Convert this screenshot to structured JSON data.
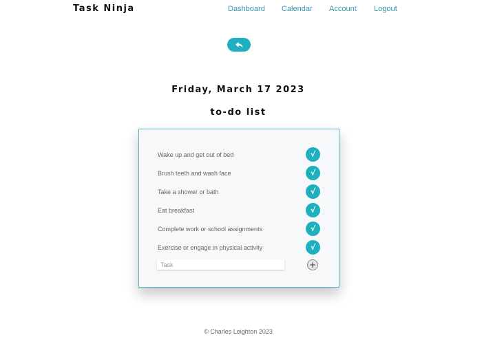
{
  "header": {
    "brand": "Task Ninja",
    "nav": [
      "Dashboard",
      "Calendar",
      "Account",
      "Logout"
    ]
  },
  "back_button": {
    "icon": "reply-arrow-icon"
  },
  "date": "Friday, March 17 2023",
  "list_title": "to-do list",
  "tasks": [
    {
      "label": "Wake up and get out of bed",
      "done_icon": "√"
    },
    {
      "label": "Brush teeth and wash face",
      "done_icon": "√"
    },
    {
      "label": "Take a shower or bath",
      "done_icon": "√"
    },
    {
      "label": "Eat breakfast",
      "done_icon": "√"
    },
    {
      "label": "Complete work or school assignments",
      "done_icon": "√"
    },
    {
      "label": "Exercise or engage in physical activity",
      "done_icon": "√"
    }
  ],
  "new_task": {
    "placeholder": "Task",
    "value": "",
    "add_icon": "+"
  },
  "footer": "© Charles Leighton 2023",
  "colors": {
    "accent": "#1fb0bf",
    "nav_link": "#3a96a8",
    "card_border": "#56b3c2",
    "card_bg": "#f6f8f9"
  }
}
